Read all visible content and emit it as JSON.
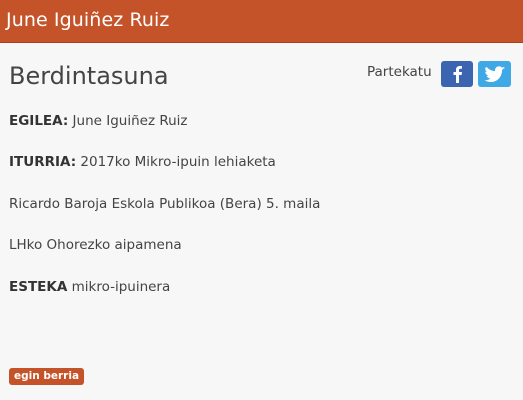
{
  "header": {
    "title": "June Iguiñez Ruiz"
  },
  "article": {
    "title": "Berdintasuna",
    "share_label": "Partekatu",
    "share_icons": [
      "facebook-icon",
      "twitter-icon"
    ],
    "author_label": "EGILEA:",
    "author_value": "June Iguiñez Ruiz",
    "source_label": "ITURRIA:",
    "source_value": "2017ko Mikro-ipuin lehiaketa",
    "school": "Ricardo Baroja Eskola Publikoa (Bera) 5. maila",
    "award": "LHko Ohorezko aipamena",
    "link_label": "ESTEKA",
    "link_value": "mikro-ipuinera"
  },
  "tag": {
    "label": "egin berria"
  },
  "colors": {
    "brand": "#c5532a",
    "facebook": "#3b65b0",
    "twitter": "#3fa9e6",
    "background": "#f7f7f7"
  }
}
